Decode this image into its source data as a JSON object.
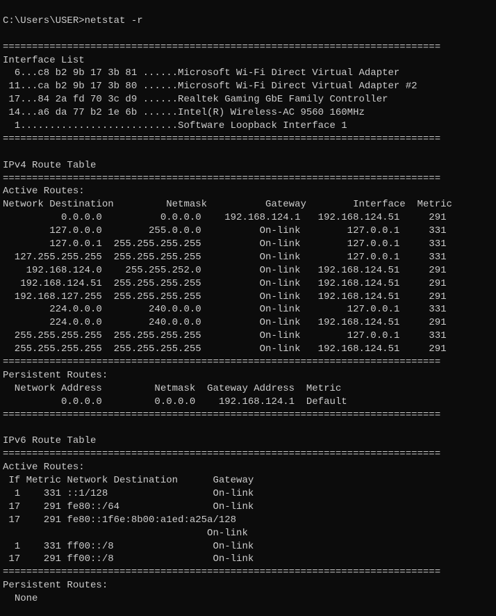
{
  "prompt": "C:\\Users\\USER>",
  "command": "netstat -r",
  "divider": "===========================================================================",
  "interface_list_header": "Interface List",
  "interfaces": [
    {
      "if": "  6",
      "mac": "c8 b2 9b 17 3b 81",
      "name": "Microsoft Wi-Fi Direct Virtual Adapter"
    },
    {
      "if": " 11",
      "mac": "ca b2 9b 17 3b 80",
      "name": "Microsoft Wi-Fi Direct Virtual Adapter #2"
    },
    {
      "if": " 17",
      "mac": "84 2a fd 70 3c d9",
      "name": "Realtek Gaming GbE Family Controller"
    },
    {
      "if": " 14",
      "mac": "a6 da 77 b2 1e 6b",
      "name": "Intel(R) Wireless-AC 9560 160MHz"
    },
    {
      "if": "  1",
      "mac": "",
      "name": "Software Loopback Interface 1"
    }
  ],
  "ipv4_header": "IPv4 Route Table",
  "active_routes_header": "Active Routes:",
  "ipv4_cols": {
    "dest": "Network Destination",
    "mask": "Netmask",
    "gw": "Gateway",
    "iface": "Interface",
    "metric": "Metric"
  },
  "ipv4_routes": [
    {
      "dest": "0.0.0.0",
      "mask": "0.0.0.0",
      "gw": "192.168.124.1",
      "iface": "192.168.124.51",
      "metric": "291"
    },
    {
      "dest": "127.0.0.0",
      "mask": "255.0.0.0",
      "gw": "On-link",
      "iface": "127.0.0.1",
      "metric": "331"
    },
    {
      "dest": "127.0.0.1",
      "mask": "255.255.255.255",
      "gw": "On-link",
      "iface": "127.0.0.1",
      "metric": "331"
    },
    {
      "dest": "127.255.255.255",
      "mask": "255.255.255.255",
      "gw": "On-link",
      "iface": "127.0.0.1",
      "metric": "331"
    },
    {
      "dest": "192.168.124.0",
      "mask": "255.255.252.0",
      "gw": "On-link",
      "iface": "192.168.124.51",
      "metric": "291"
    },
    {
      "dest": "192.168.124.51",
      "mask": "255.255.255.255",
      "gw": "On-link",
      "iface": "192.168.124.51",
      "metric": "291"
    },
    {
      "dest": "192.168.127.255",
      "mask": "255.255.255.255",
      "gw": "On-link",
      "iface": "192.168.124.51",
      "metric": "291"
    },
    {
      "dest": "224.0.0.0",
      "mask": "240.0.0.0",
      "gw": "On-link",
      "iface": "127.0.0.1",
      "metric": "331"
    },
    {
      "dest": "224.0.0.0",
      "mask": "240.0.0.0",
      "gw": "On-link",
      "iface": "192.168.124.51",
      "metric": "291"
    },
    {
      "dest": "255.255.255.255",
      "mask": "255.255.255.255",
      "gw": "On-link",
      "iface": "127.0.0.1",
      "metric": "331"
    },
    {
      "dest": "255.255.255.255",
      "mask": "255.255.255.255",
      "gw": "On-link",
      "iface": "192.168.124.51",
      "metric": "291"
    }
  ],
  "persistent_header": "Persistent Routes:",
  "persistent_cols": {
    "addr": "Network Address",
    "mask": "Netmask",
    "gw": "Gateway Address",
    "metric": "Metric"
  },
  "persistent_routes": [
    {
      "addr": "0.0.0.0",
      "mask": "0.0.0.0",
      "gw": "192.168.124.1",
      "metric": "Default"
    }
  ],
  "ipv6_header": "IPv6 Route Table",
  "ipv6_cols": {
    "if": "If",
    "metric": "Metric",
    "dest": "Network Destination",
    "gw": "Gateway"
  },
  "ipv6_routes": [
    {
      "if": "1",
      "metric": "331",
      "dest": "::1/128",
      "gw": "On-link"
    },
    {
      "if": "17",
      "metric": "291",
      "dest": "fe80::/64",
      "gw": "On-link"
    },
    {
      "if": "17",
      "metric": "291",
      "dest": "fe80::1f6e:8b00:a1ed:a25a/128",
      "gw": "On-link"
    },
    {
      "if": "1",
      "metric": "331",
      "dest": "ff00::/8",
      "gw": "On-link"
    },
    {
      "if": "17",
      "metric": "291",
      "dest": "ff00::/8",
      "gw": "On-link"
    }
  ],
  "none_text": "None"
}
